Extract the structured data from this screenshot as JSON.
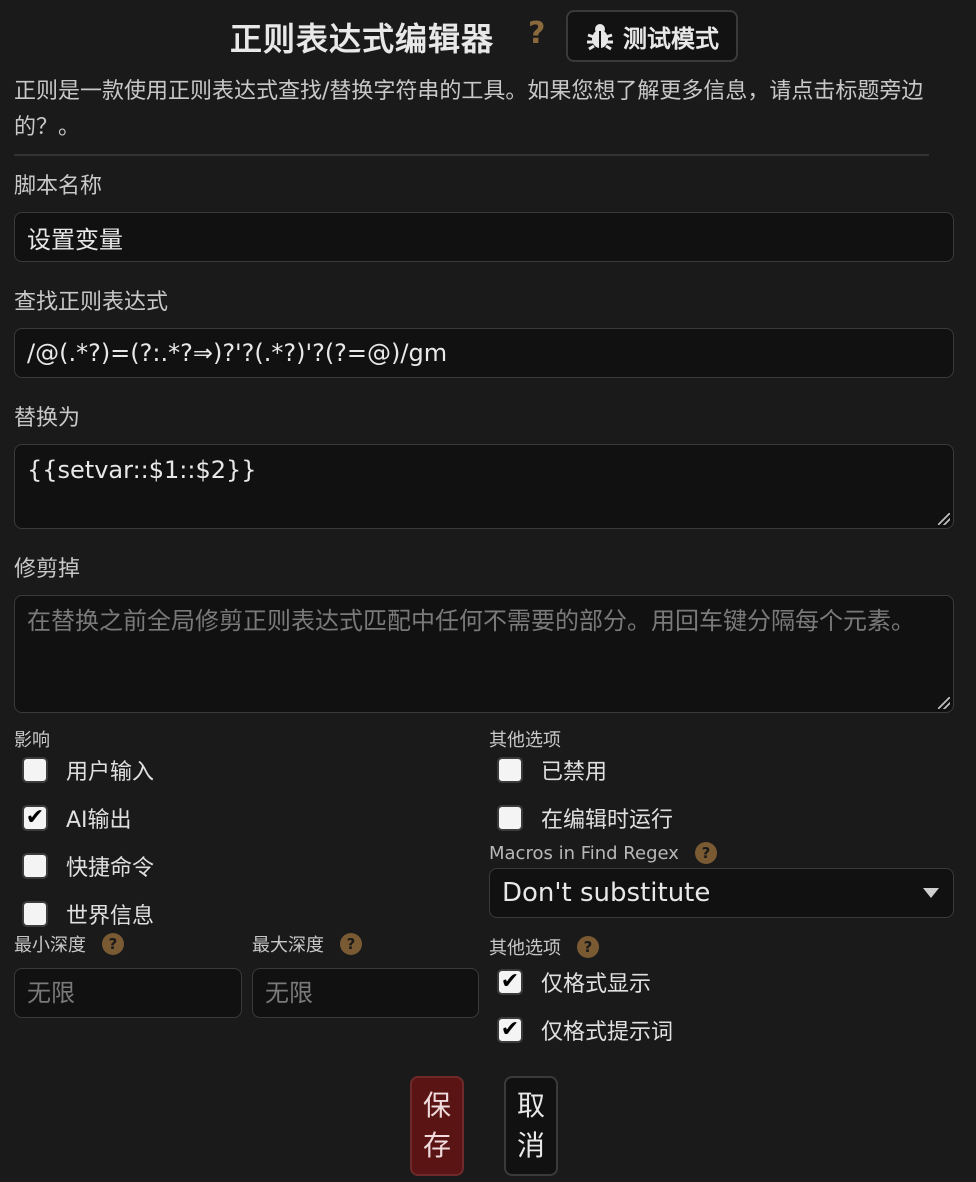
{
  "header": {
    "title": "正则表达式编辑器",
    "help_glyph": "?",
    "test_mode_label": "测试模式"
  },
  "description": "正则是一款使用正则表达式查找/替换字符串的工具。如果您想了解更多信息，请点击标题旁边的？。",
  "script_name": {
    "label": "脚本名称",
    "value": "设置变量"
  },
  "find_regex": {
    "label": "查找正则表达式",
    "value": "/@(.*?)=(?:.*?⇒)?'?(.*?)'?(?=@)/gm"
  },
  "replace_with": {
    "label": "替换为",
    "value": "{{setvar::$1::$2}}"
  },
  "trim_out": {
    "label": "修剪掉",
    "placeholder": "在替换之前全局修剪正则表达式匹配中任何不需要的部分。用回车键分隔每个元素。"
  },
  "affects": {
    "label": "影响",
    "items": [
      {
        "label": "用户输入",
        "checked": false,
        "mark": ""
      },
      {
        "label": "AI输出",
        "checked": true,
        "mark": "✔"
      },
      {
        "label": "快捷命令",
        "checked": false,
        "mark": ""
      },
      {
        "label": "世界信息",
        "checked": false,
        "mark": ""
      }
    ]
  },
  "other_options": {
    "label": "其他选项",
    "items": [
      {
        "label": "已禁用",
        "checked": false,
        "mark": ""
      },
      {
        "label": "在编辑时运行",
        "checked": false,
        "mark": ""
      }
    ]
  },
  "macros": {
    "label": "Macros in Find Regex",
    "selected": "Don't substitute"
  },
  "depth": {
    "min_label": "最小深度",
    "max_label": "最大深度",
    "min_placeholder": "无限",
    "max_placeholder": "无限"
  },
  "other_options_2": {
    "label": "其他选项",
    "items": [
      {
        "label": "仅格式显示",
        "checked": true,
        "mark": "✔"
      },
      {
        "label": "仅格式提示词",
        "checked": true,
        "mark": "✔"
      }
    ]
  },
  "buttons": {
    "save_chars": [
      "保",
      "存"
    ],
    "cancel_chars": [
      "取",
      "消"
    ]
  },
  "colors": {
    "save_bg": "#5a1414",
    "help_icon": "#7a5a33",
    "background": "#1a1a1a"
  }
}
